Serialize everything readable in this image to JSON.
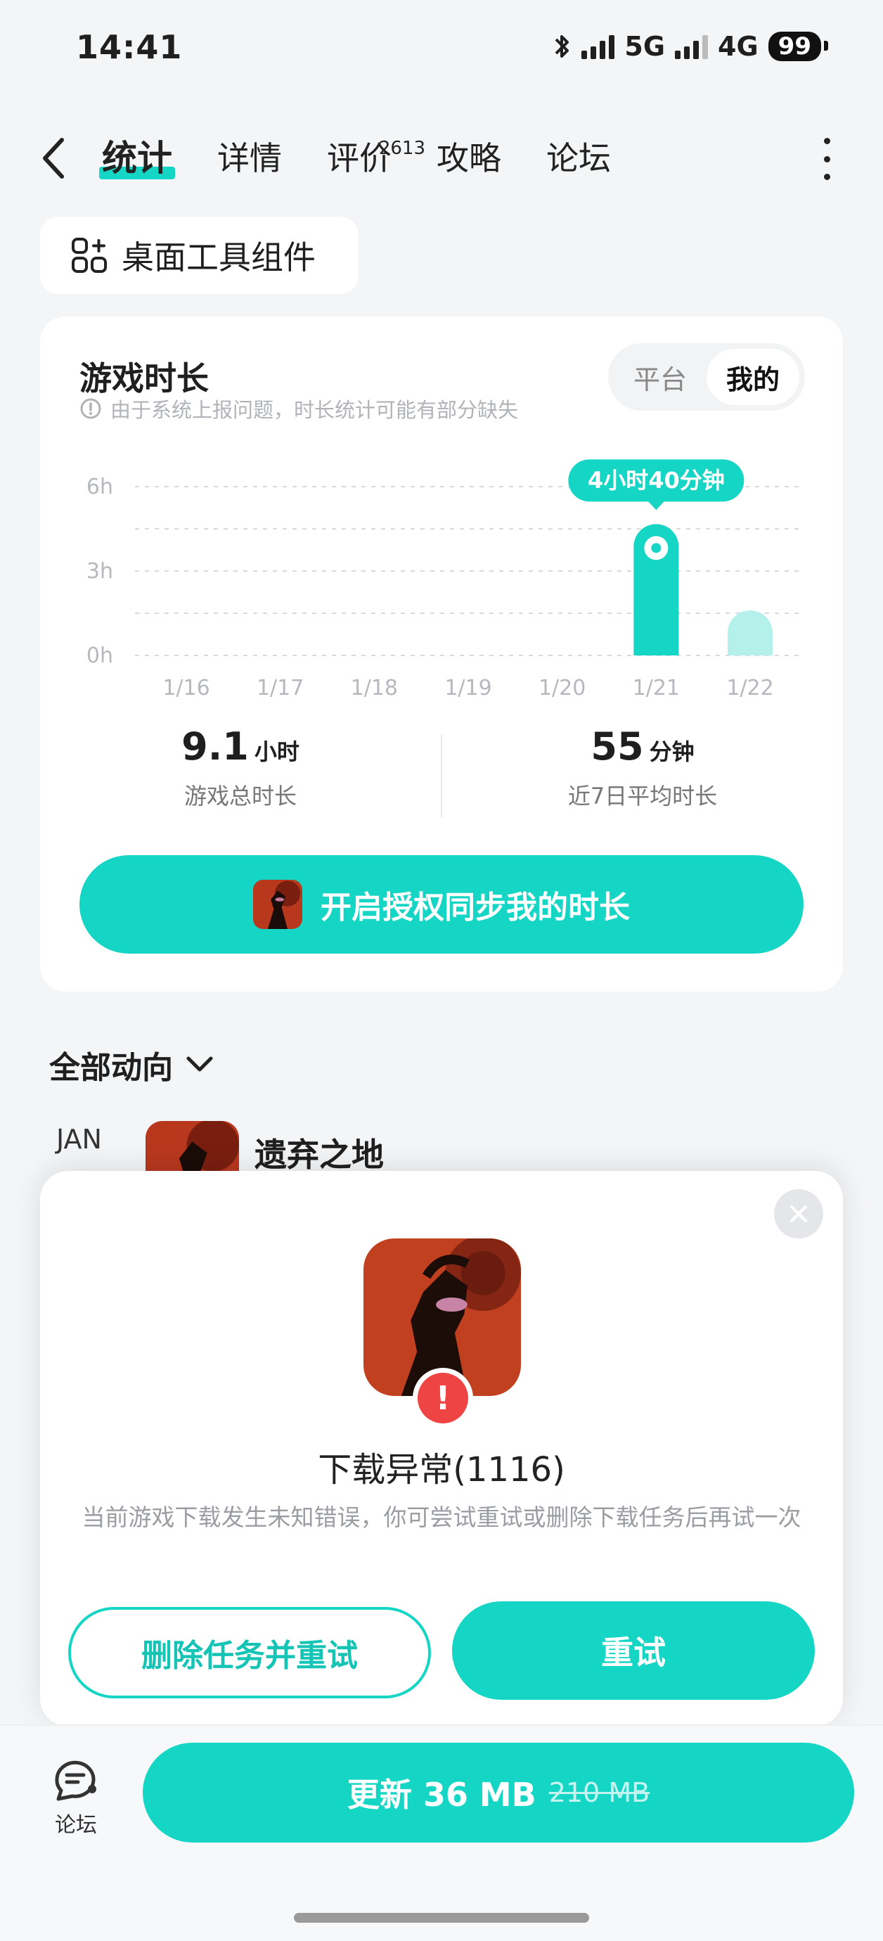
{
  "status_bar": {
    "time": "14:41",
    "network_1": "5G",
    "network_2": "4G",
    "battery": "99"
  },
  "header": {
    "tabs": [
      {
        "label": "统计",
        "active": true
      },
      {
        "label": "详情"
      },
      {
        "label": "评价",
        "badge": "2613"
      },
      {
        "label": "攻略"
      },
      {
        "label": "论坛"
      }
    ]
  },
  "widget_chip": {
    "label": "桌面工具组件"
  },
  "stats": {
    "title": "游戏时长",
    "note": "由于系统上报问题，时长统计可能有部分缺失",
    "toggle": {
      "platform": "平台",
      "mine": "我的",
      "selected": "我的"
    },
    "total": {
      "value": "9.1",
      "unit": "小时",
      "label": "游戏总时长"
    },
    "average": {
      "value": "55",
      "unit": "分钟",
      "label": "近7日平均时长"
    },
    "auth_button": "开启授权同步我的时长"
  },
  "chart_data": {
    "type": "bar",
    "categories": [
      "1/16",
      "1/17",
      "1/18",
      "1/19",
      "1/20",
      "1/21",
      "1/22"
    ],
    "values": [
      0,
      0,
      0,
      0,
      0,
      4.67,
      1.6
    ],
    "y_ticks": [
      "0h",
      "3h",
      "6h"
    ],
    "ylim": [
      0,
      6
    ],
    "highlight": {
      "index": 5,
      "label": "4小时40分钟"
    },
    "colors": {
      "active": "#15d5c4",
      "light": "#b5f1eb"
    }
  },
  "activity": {
    "filter_label": "全部动向",
    "month": "JAN",
    "game_title": "遗弃之地"
  },
  "popup": {
    "title": "下载异常(1116)",
    "description": "当前游戏下载发生未知错误，你可尝试重试或删除下载任务后再试一次",
    "delete_retry": "删除任务并重试",
    "retry": "重试"
  },
  "bottom_bar": {
    "forum_label": "论坛",
    "update_label": "更新 36 MB",
    "original_size": "210 MB"
  },
  "colors": {
    "accent": "#15d5c4",
    "error": "#ef4444"
  }
}
